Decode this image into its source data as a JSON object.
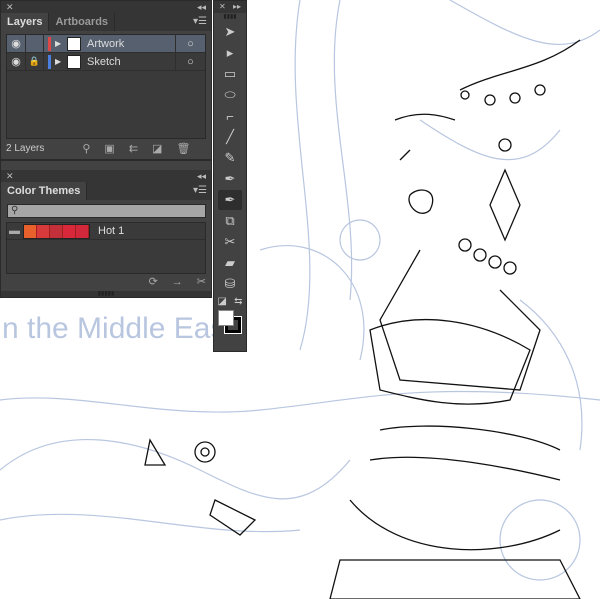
{
  "layers_panel": {
    "tabs": [
      "Layers",
      "Artboards"
    ],
    "active_tab": "Layers",
    "layers": [
      {
        "name": "Artwork",
        "color": "#e04848",
        "visible": true,
        "locked": false,
        "selected": true
      },
      {
        "name": "Sketch",
        "color": "#4a7fe0",
        "visible": true,
        "locked": true,
        "selected": false
      }
    ],
    "count_label": "2 Layers"
  },
  "color_themes_panel": {
    "title": "Color Themes",
    "search_placeholder": "",
    "themes": [
      {
        "name": "Hot 1",
        "swatches": [
          "#e8602c",
          "#d63a3a",
          "#c4303a",
          "#d8283a",
          "#d2283c"
        ]
      }
    ]
  },
  "toolbar": {
    "tools": [
      "selection",
      "direct-selection",
      "rectangle",
      "ellipse",
      "polygon",
      "line",
      "pencil",
      "pen",
      "pen-anchor",
      "shape-builder",
      "scissors",
      "eraser",
      "symbol-sprayer"
    ],
    "active_tool": "pen-anchor"
  },
  "canvas": {
    "sketch_text": "n the Middle East"
  }
}
